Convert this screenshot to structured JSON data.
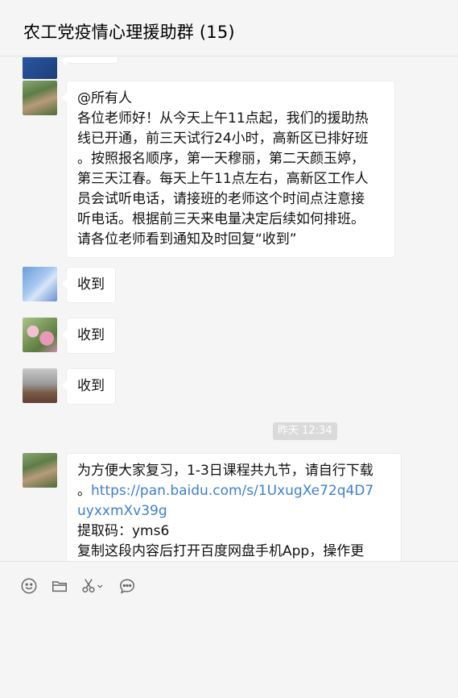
{
  "header": {
    "title": "农工党疫情心理援助群 (15)"
  },
  "messages": [
    {
      "sender_avatar": "landscape-photo-avatar",
      "lines": [
        "@所有人",
        "各位老师好！从今天上午11点起，我们的援助热",
        "线已开通，前三天试行24小时，高新区已排好班",
        "。按照报名顺序，第一天穆丽，第二天颜玉婷，",
        "第三天江春。每天上午11点左右，高新区工作人",
        "员会试听电话，请接班的老师这个时间点注意接",
        "听电话。根据前三天来电量决定后续如何排班。",
        "请各位老师看到通知及时回复“收到”"
      ]
    },
    {
      "sender_avatar": "blossom-photo-avatar",
      "text": "收到"
    },
    {
      "sender_avatar": "flower-photo-avatar",
      "text": "收到"
    },
    {
      "sender_avatar": "city-photo-avatar",
      "text": "收到"
    },
    {
      "sender_avatar": "landscape-photo-avatar",
      "line1": "为方便大家复习，1-3日课程共九节，请自行下载",
      "line2_prefix": "。",
      "link_part1": "https://pan.baidu.com/s/1UxugXe72q4D7",
      "link_part2": "uyxxmXv39g",
      "line4": "提取码：yms6",
      "line5": "复制这段内容后打开百度网盘手机App，操作更"
    }
  ],
  "timestamp": "昨天 12:34",
  "toolbar": {
    "icons": [
      "emoji-icon",
      "folder-icon",
      "scissors-icon",
      "chat-bubble-icon"
    ]
  }
}
